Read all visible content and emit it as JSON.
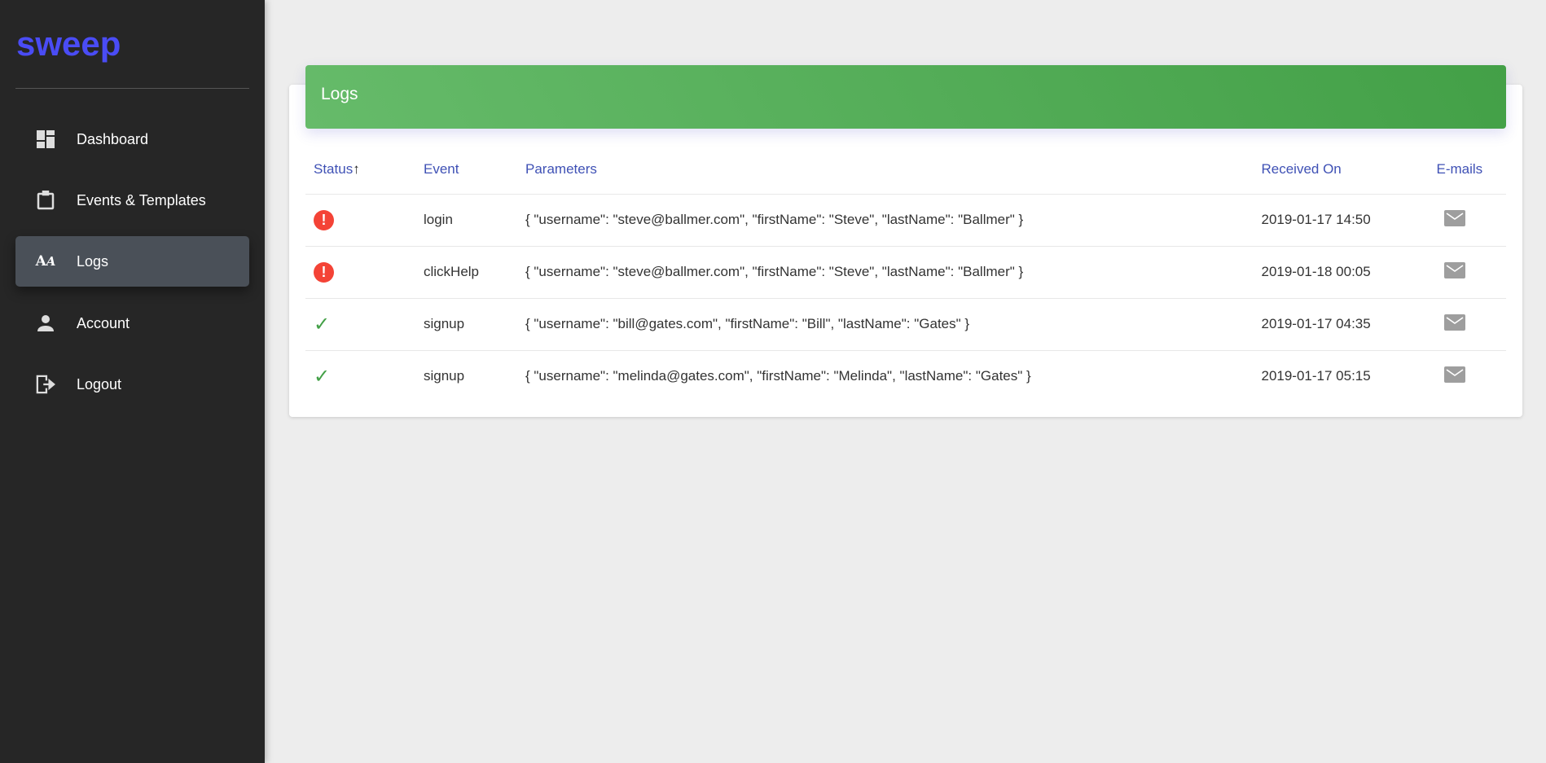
{
  "app": {
    "logo": "sweep"
  },
  "sidebar": {
    "items": [
      {
        "label": "Dashboard",
        "icon": "dashboard-icon"
      },
      {
        "label": "Events & Templates",
        "icon": "clipboard-icon"
      },
      {
        "label": "Logs",
        "icon": "font-download-icon",
        "active": true
      },
      {
        "label": "Account",
        "icon": "person-icon"
      },
      {
        "label": "Logout",
        "icon": "exit-icon"
      }
    ]
  },
  "card": {
    "title": "Logs"
  },
  "table": {
    "headers": [
      "Status",
      "Event",
      "Parameters",
      "Received On",
      "E-mails"
    ],
    "sort_indicator": "↑",
    "rows": [
      {
        "status": "error",
        "event": "login",
        "parameters": "{ \"username\": \"steve@ballmer.com\", \"firstName\": \"Steve\", \"lastName\": \"Ballmer\" }",
        "received": "2019-01-17 14:50"
      },
      {
        "status": "error",
        "event": "clickHelp",
        "parameters": "{ \"username\": \"steve@ballmer.com\", \"firstName\": \"Steve\", \"lastName\": \"Ballmer\" }",
        "received": "2019-01-18 00:05"
      },
      {
        "status": "success",
        "event": "signup",
        "parameters": "{ \"username\": \"bill@gates.com\", \"firstName\": \"Bill\", \"lastName\": \"Gates\" }",
        "received": "2019-01-17 04:35"
      },
      {
        "status": "success",
        "event": "signup",
        "parameters": "{ \"username\": \"melinda@gates.com\", \"firstName\": \"Melinda\", \"lastName\": \"Gates\" }",
        "received": "2019-01-17 05:15"
      }
    ]
  },
  "colors": {
    "brand": "#4a4cf5",
    "header_green": "#4caf50",
    "error": "#f44336",
    "success": "#43a047",
    "link": "#3f51b5"
  }
}
